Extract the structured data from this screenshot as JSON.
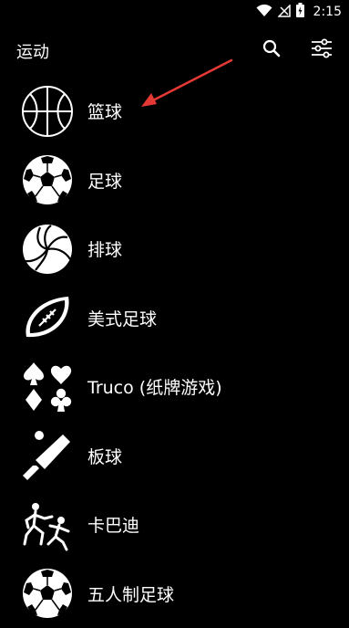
{
  "status_bar": {
    "time": "2:15",
    "icons": [
      "wifi-icon",
      "no-signal-icon",
      "battery-charging-icon"
    ]
  },
  "app_bar": {
    "title": "运动",
    "search_icon": "search-icon",
    "filter_icon": "filter-settings-icon"
  },
  "sports": [
    {
      "label": "篮球",
      "icon": "basketball-icon"
    },
    {
      "label": "足球",
      "icon": "soccer-ball-icon"
    },
    {
      "label": "排球",
      "icon": "volleyball-icon"
    },
    {
      "label": "美式足球",
      "icon": "american-football-icon"
    },
    {
      "label": "Truco (纸牌游戏)",
      "icon": "card-suits-icon"
    },
    {
      "label": "板球",
      "icon": "cricket-bat-icon"
    },
    {
      "label": "卡巴迪",
      "icon": "kabaddi-icon"
    },
    {
      "label": "五人制足球",
      "icon": "futsal-ball-icon"
    }
  ],
  "annotation": {
    "arrow_color": "#e53935"
  }
}
